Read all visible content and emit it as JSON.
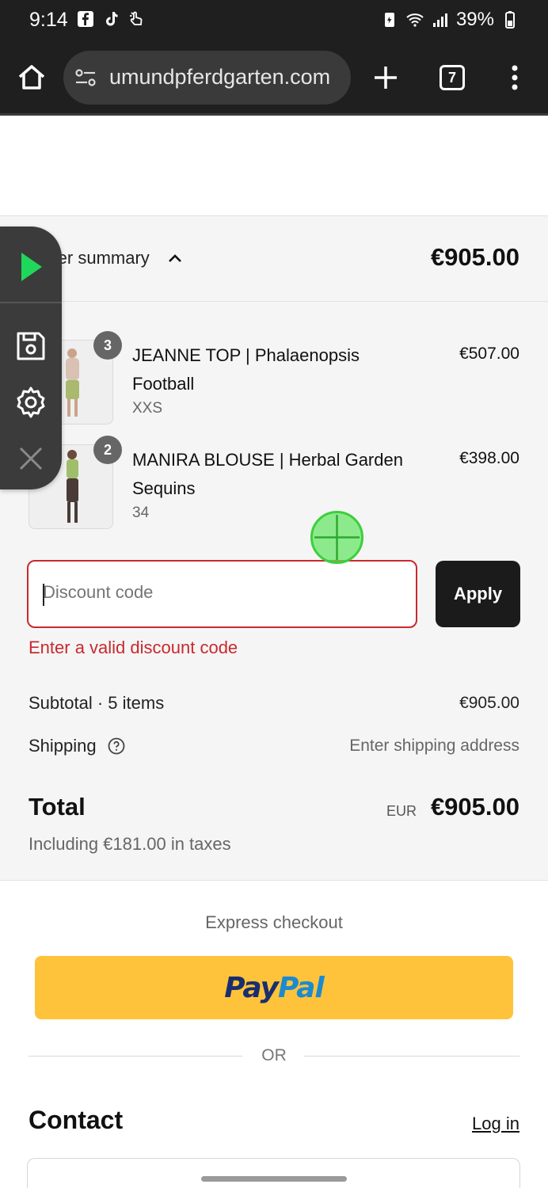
{
  "status_bar": {
    "time": "9:14",
    "battery": "39%",
    "left_icons": [
      "facebook-icon",
      "tiktok-icon",
      "gesture-icon"
    ],
    "right_icons": [
      "battery-saver-icon",
      "wifi-icon",
      "signal-icon",
      "battery-icon"
    ]
  },
  "browser": {
    "url": "umundpferdgarten.com",
    "tab_count": "7"
  },
  "order_summary": {
    "title": "Order summary",
    "total": "€905.00",
    "items": [
      {
        "name": "JEANNE TOP | Phalaenopsis Football",
        "variant": "XXS",
        "quantity": "3",
        "price": "€507.00"
      },
      {
        "name": "MANIRA BLOUSE | Herbal Garden Sequins",
        "variant": "34",
        "quantity": "2",
        "price": "€398.00"
      }
    ],
    "discount": {
      "placeholder": "Discount code",
      "value": "",
      "apply_label": "Apply",
      "error": "Enter a valid discount code"
    },
    "subtotal_label": "Subtotal · 5 items",
    "subtotal_value": "€905.00",
    "shipping_label": "Shipping",
    "shipping_value": "Enter shipping address",
    "total_label": "Total",
    "total_currency": "EUR",
    "total_value": "€905.00",
    "tax_note": "Including €181.00 in taxes"
  },
  "express": {
    "label": "Express checkout",
    "paypal_pay": "Pay",
    "paypal_pal": "Pal",
    "or": "OR"
  },
  "contact": {
    "heading": "Contact",
    "login": "Log in"
  },
  "colors": {
    "error": "#c8292e",
    "paypal_yellow": "#fec33a",
    "dark_button": "#1b1b1b",
    "touch_indicator": "#60e660"
  }
}
